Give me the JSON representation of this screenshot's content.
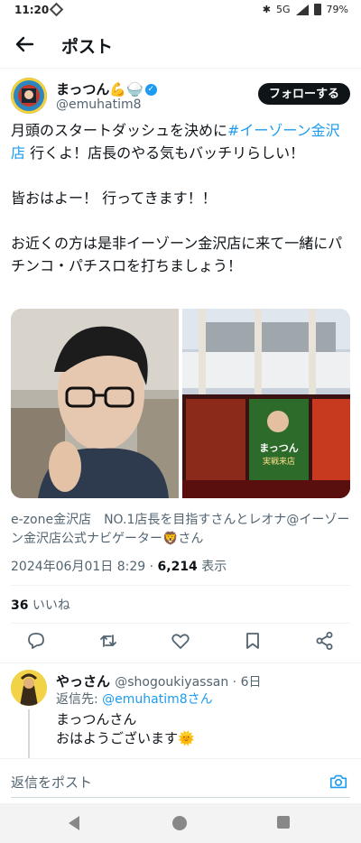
{
  "status_bar": {
    "time": "11:20",
    "network": "5G",
    "battery": "79%"
  },
  "header": {
    "title": "ポスト"
  },
  "author": {
    "name": "まっつん💪🍚",
    "handle": "@emuhatim8",
    "follow_label": "フォローする"
  },
  "tweet": {
    "line1_prefix": "月頭のスタートダッシュを決めに",
    "hashtag": "#イーゾーン金沢店",
    "line1_suffix": " 行くよ！店長のやる気もバッチリらしい！",
    "para2": "皆おはよー！ 行ってきます！！",
    "para3": "お近くの方は是非イーゾーン金沢店に来て一緒にパチンコ・パチスロを打ちましょう！"
  },
  "media": {
    "poster_title": "まっつん",
    "poster_subtitle": "実戦来店"
  },
  "tagged": "e-zone金沢店　NO.1店長を目指すさんとレオナ@イーゾーン金沢店公式ナビゲーター🦁さん",
  "meta": {
    "date": "2024年06月01日 8:29",
    "dot": " · ",
    "views": "6,214",
    "views_label": " 表示"
  },
  "likes": {
    "count": "36",
    "label": " いいね"
  },
  "reply": {
    "name": "やっさん",
    "handle": "@shogoukiyassan",
    "time": " · 6日",
    "replying_label": "返信先: ",
    "replying_to": "@emuhatim8さん",
    "line1": "まっつんさん",
    "line2": "おはようございます🌞"
  },
  "composer": {
    "placeholder": "返信をポスト"
  },
  "colors": {
    "accent": "#1d9bf0",
    "text": "#0f1419",
    "muted": "#536471"
  }
}
